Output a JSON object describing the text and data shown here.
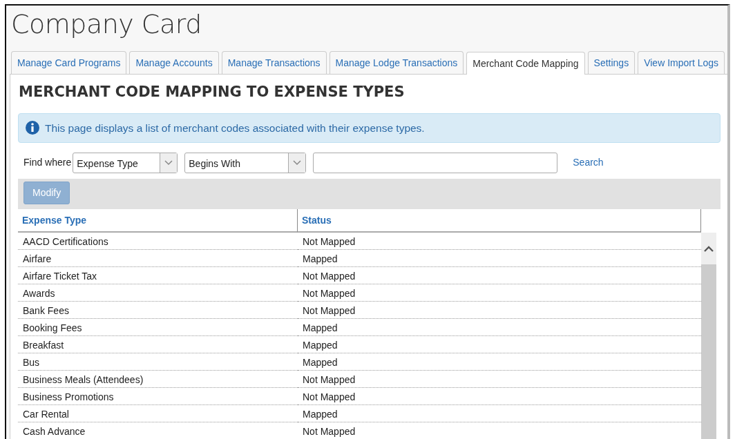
{
  "title": "Company Card",
  "tabs": [
    {
      "label": "Manage Card Programs",
      "selected": false
    },
    {
      "label": "Manage Accounts",
      "selected": false
    },
    {
      "label": "Manage Transactions",
      "selected": false
    },
    {
      "label": "Manage Lodge Transactions",
      "selected": false
    },
    {
      "label": "Merchant Code Mapping",
      "selected": true
    },
    {
      "label": "Settings",
      "selected": false
    },
    {
      "label": "View Import Logs",
      "selected": false
    }
  ],
  "heading": "MERCHANT CODE MAPPING TO EXPENSE TYPES",
  "info": "This page displays a list of merchant codes associated with their expense types.",
  "search": {
    "label": "Find where",
    "field": "Expense Type",
    "operator": "Begins With",
    "button": "Search"
  },
  "toolbar": {
    "button": "Modify",
    "disabled": true
  },
  "table": {
    "columns": [
      "Expense Type",
      "Status"
    ],
    "rows": [
      [
        "AACD Certifications",
        "Not Mapped"
      ],
      [
        "Airfare",
        "Mapped"
      ],
      [
        "Airfare Ticket Tax",
        "Not Mapped"
      ],
      [
        "Awards",
        "Not Mapped"
      ],
      [
        "Bank Fees",
        "Not Mapped"
      ],
      [
        "Booking Fees",
        "Mapped"
      ],
      [
        "Breakfast",
        "Mapped"
      ],
      [
        "Bus",
        "Mapped"
      ],
      [
        "Business Meals (Attendees)",
        "Not Mapped"
      ],
      [
        "Business Promotions",
        "Not Mapped"
      ],
      [
        "Car Rental",
        "Mapped"
      ],
      [
        "Cash Advance",
        "Not Mapped"
      ]
    ]
  }
}
